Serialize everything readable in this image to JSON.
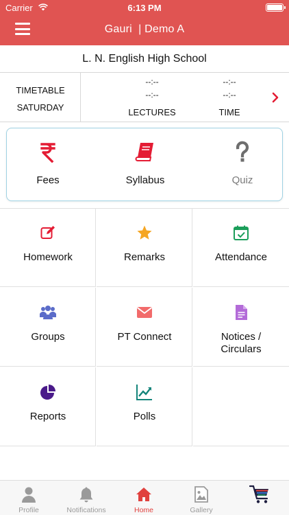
{
  "status_bar": {
    "carrier": "Carrier",
    "time": "6:13 PM"
  },
  "nav": {
    "title": "Gauri  | Demo A"
  },
  "school": {
    "name": "L. N. English High School"
  },
  "timetable": {
    "title": "TIMETABLE",
    "day": "SATURDAY",
    "lectures_placeholder_1": "--:--",
    "lectures_placeholder_2": "--:--",
    "time_placeholder_1": "--:--",
    "time_placeholder_2": "--:--",
    "lectures_label": "LECTURES",
    "time_label": "TIME"
  },
  "featured": [
    {
      "label": "Fees",
      "icon": "rupee-icon",
      "color": "#e41c34"
    },
    {
      "label": "Syllabus",
      "icon": "book-icon",
      "color": "#e41c34"
    },
    {
      "label": "Quiz",
      "icon": "question-icon",
      "color": "#777777"
    }
  ],
  "modules": [
    {
      "label": "Homework",
      "icon": "edit-icon",
      "color": "#e41c34"
    },
    {
      "label": "Remarks",
      "icon": "star-icon",
      "color": "#f5a623"
    },
    {
      "label": "Attendance",
      "icon": "calendar-check-icon",
      "color": "#1b9e5a"
    },
    {
      "label": "Groups",
      "icon": "users-icon",
      "color": "#5b6cc9"
    },
    {
      "label": "PT Connect",
      "icon": "envelope-icon",
      "color": "#f26b6b"
    },
    {
      "label": "Notices /\nCirculars",
      "icon": "document-icon",
      "color": "#b36bd8"
    },
    {
      "label": "Reports",
      "icon": "pie-chart-icon",
      "color": "#4a1a8a"
    },
    {
      "label": "Polls",
      "icon": "line-chart-icon",
      "color": "#13847a"
    }
  ],
  "tabs": [
    {
      "label": "Profile",
      "icon": "person-icon"
    },
    {
      "label": "Notifications",
      "icon": "bell-icon"
    },
    {
      "label": "Home",
      "icon": "home-icon",
      "active": true
    },
    {
      "label": "Gallery",
      "icon": "image-icon"
    },
    {
      "label": "",
      "icon": "cart-icon"
    }
  ],
  "colors": {
    "header": "#e05452",
    "accent": "#e0413e",
    "card_border": "#9fd2e3"
  }
}
